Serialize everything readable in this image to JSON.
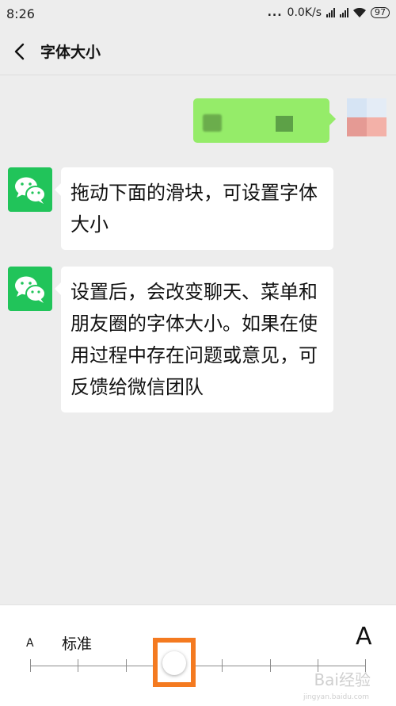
{
  "status_bar": {
    "time": "8:26",
    "dots": "...",
    "network_speed": "0.0K/s",
    "battery": "97"
  },
  "header": {
    "title": "字体大小",
    "back_icon": "chevron-left-icon"
  },
  "messages": [
    {
      "text": "拖动下面的滑块，可设置字体大小",
      "avatar": "wechat-logo-icon"
    },
    {
      "text": "设置后，会改变聊天、菜单和朋友圈的字体大小。如果在使用过程中存在问题或意见，可反馈给微信团队",
      "avatar": "wechat-logo-icon"
    }
  ],
  "font_size_control": {
    "small_label": "A",
    "large_label": "A",
    "current_label": "标准",
    "selected_step": 3,
    "step_count": 8
  },
  "colors": {
    "outgoing_bubble": "#95ec69",
    "wechat_green": "#21c45a",
    "highlight": "#f47a20"
  }
}
